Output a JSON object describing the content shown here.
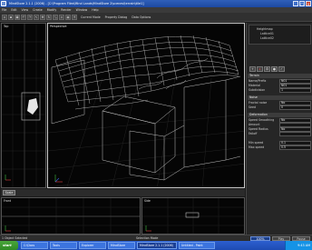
{
  "window": {
    "title": "MindStore 2.1.1 (2006) - [C:\\Program Files\\Mind Lands\\MindStore 2\\scenes\\terrain\\tile1]",
    "icon": "app-icon",
    "min_glyph": "_",
    "max_glyph": "□",
    "close_glyph": "×"
  },
  "menu": [
    "File",
    "Edit",
    "View",
    "Create",
    "Modify",
    "Render",
    "Window",
    "Help"
  ],
  "toolbar": {
    "icons": [
      "new-icon",
      "open-icon",
      "save-icon",
      "undo-icon",
      "redo-icon",
      "select-icon",
      "move-icon",
      "rotate-icon",
      "scale-icon",
      "link-icon",
      "camera-icon",
      "light-icon"
    ],
    "glyphs": [
      "▫",
      "▪",
      "▣",
      "↶",
      "↷",
      "↖",
      "✥",
      "↻",
      "⤡",
      "∞",
      "◉",
      "☀"
    ],
    "labels": [
      "Current Mode",
      "Property Dialog",
      "Data Options"
    ]
  },
  "viewports": {
    "top": "Top",
    "perspective": "Perspective",
    "front": "Front",
    "side": "Side",
    "scale_button": "Scale"
  },
  "panel": {
    "tree": [
      "Heightmap",
      "Lattice01",
      "Lattice02"
    ],
    "tools": [
      "+",
      "x",
      "⚙",
      "●",
      "✓"
    ],
    "sections": [
      {
        "header": "Terrain",
        "rows": [
          {
            "label": "Name/Prefix",
            "value": "N01"
          },
          {
            "label": "Material",
            "value": "N01"
          },
          {
            "label": "Subdivision",
            "value": "1"
          }
        ]
      },
      {
        "header": "Noise",
        "rows": [
          {
            "label": "Fractal noise",
            "value": "No"
          },
          {
            "label": "Seed",
            "value": "0"
          }
        ]
      },
      {
        "header": "Deformation",
        "rows": [
          {
            "label": "Speed Smoothing",
            "value": "No"
          },
          {
            "label": "Amount",
            "value": ""
          },
          {
            "label": "Speed Radius",
            "value": "No"
          },
          {
            "label": "Falloff",
            "value": ""
          }
        ]
      },
      {
        "header": "",
        "rows": [
          {
            "label": "Min speed",
            "value": "0.1"
          },
          {
            "label": "Max speed",
            "value": "0.5"
          }
        ]
      }
    ]
  },
  "status": {
    "left": "1 Object Selected",
    "middle": "Selection Mode",
    "zoom": "100%",
    "right_buttons": [
      "Play",
      "Pause"
    ]
  },
  "taskbar": {
    "start": "start",
    "tasks": [
      "C:\\Docs",
      "Tools",
      "Explorer",
      "MindStore",
      "MindStore 2.1.1 (2006)",
      "Untitled - Paint"
    ],
    "time": "9:43 AM"
  },
  "colors": {
    "wire": "#e8e8e8",
    "accent": "#1d49a0",
    "box": "#bfbfbf"
  }
}
